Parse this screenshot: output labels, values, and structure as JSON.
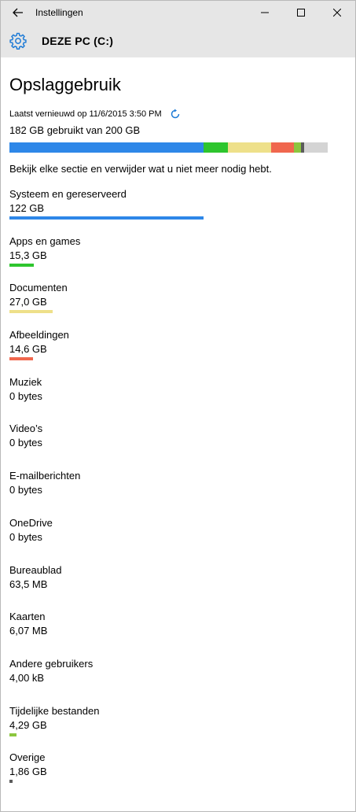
{
  "window": {
    "title": "Instellingen"
  },
  "header": {
    "drive_title": "DEZE PC (C:)"
  },
  "page": {
    "title": "Opslaggebruik",
    "last_refreshed": "Laatst vernieuwd op 11/6/2015 3:50 PM",
    "usage": "182 GB gebruikt van 200 GB",
    "hint": "Bekijk elke sectie en verwijder wat u niet meer nodig hebt."
  },
  "total": 200,
  "colors": {
    "system": "#2e87e8",
    "apps": "#2ec52e",
    "documents": "#eee08a",
    "pictures": "#f0674e",
    "temp": "#8cc63f",
    "other": "#5b5b5b",
    "free": "#d4d4d4",
    "accent": "#1e7bd6"
  },
  "categories": [
    {
      "name": "Systeem en gereserveerd",
      "size": "122 GB",
      "color": "#2e87e8",
      "bar_gb": 122
    },
    {
      "name": "Apps en games",
      "size": "15,3 GB",
      "color": "#2ec52e",
      "bar_gb": 15.3
    },
    {
      "name": "Documenten",
      "size": "27,0 GB",
      "color": "#eee08a",
      "bar_gb": 27.0
    },
    {
      "name": "Afbeeldingen",
      "size": "14,6 GB",
      "color": "#f0674e",
      "bar_gb": 14.6
    },
    {
      "name": "Muziek",
      "size": "0 bytes",
      "color": "",
      "bar_gb": 0
    },
    {
      "name": "Video’s",
      "size": "0 bytes",
      "color": "",
      "bar_gb": 0
    },
    {
      "name": "E-mailberichten",
      "size": "0 bytes",
      "color": "",
      "bar_gb": 0
    },
    {
      "name": "OneDrive",
      "size": "0 bytes",
      "color": "",
      "bar_gb": 0
    },
    {
      "name": "Bureaublad",
      "size": "63,5 MB",
      "color": "",
      "bar_gb": 0
    },
    {
      "name": "Kaarten",
      "size": "6,07 MB",
      "color": "",
      "bar_gb": 0
    },
    {
      "name": "Andere gebruikers",
      "size": "4,00 kB",
      "color": "",
      "bar_gb": 0
    },
    {
      "name": "Tijdelijke bestanden",
      "size": "4,29 GB",
      "color": "#8cc63f",
      "bar_gb": 4.29
    },
    {
      "name": "Overige",
      "size": "1,86 GB",
      "color": "#5b5b5b",
      "bar_gb": 1.86
    }
  ]
}
